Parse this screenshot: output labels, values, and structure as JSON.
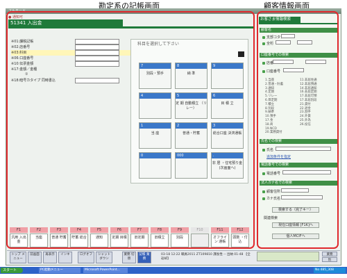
{
  "callouts": {
    "left": "勘定系の記帳画面",
    "right": "顧客情報画面"
  },
  "window": {
    "title": "フルモード"
  },
  "header": {
    "status": "● 通知可",
    "code_title": "51341 入出金"
  },
  "left_form": {
    "fields": [
      "※01:課税記帳",
      "※02:店番号",
      "※03:科目",
      "※06:口座番号",
      "※10:伝票金額",
      "※17:金額／金種",
      "①",
      "※18:暗号カタイプ 同時書込"
    ]
  },
  "keypad": {
    "prompt": "科目を選択して下さい",
    "keys": [
      {
        "num": "7",
        "label": "別段・預手"
      },
      {
        "num": "8",
        "label": "納 準"
      },
      {
        "num": "9",
        "label": ""
      },
      {
        "num": "4",
        "label": ""
      },
      {
        "num": "5",
        "label": "定 期 自動積立 （リレー）"
      },
      {
        "num": "6",
        "label": "目 積 立"
      },
      {
        "num": "1",
        "label": "当 座"
      },
      {
        "num": "2",
        "label": "普通・貯蓄"
      },
      {
        "num": "3",
        "label": "総合口座 決済通帳"
      },
      {
        "num": "0",
        "label": ""
      },
      {
        "num": "000",
        "label": ""
      },
      {
        "num": ".",
        "label": "非 居 ・住宅預り金 (次画面へ)"
      }
    ]
  },
  "fkeys": {
    "labels": [
      "F1",
      "F2",
      "F3",
      "F4",
      "F5",
      "F6",
      "F7",
      "F8",
      "F9",
      "F10",
      "F11",
      "F12"
    ],
    "buttons": [
      "汎用 入出金",
      "当座",
      "普通 貯蓄",
      "貯蓄 総合",
      "通知",
      "定期 目積",
      "旧定期",
      "旧積立",
      "別段",
      "",
      "オフライン 通帳",
      "頭数 ・付込"
    ]
  },
  "right_panel": {
    "title": "お客さま情報検索",
    "sec1": "顧客名",
    "sec1_fields": [
      "支部コタテ",
      "全桁"
    ],
    "sec2": "口座番号での検索",
    "sec2_fields": [
      "店番",
      "口座番号"
    ],
    "list_left": [
      "1.当座",
      "2.普通・貯蓄",
      "3.通知",
      "4.定期",
      "5.リレー",
      "6.目定期",
      "7.積立",
      "8.別段",
      "9.納準",
      "10.預手",
      "17.金",
      "18.商",
      "19.NCD",
      "20.業務貸付"
    ],
    "list_right": [
      "11.非居住通",
      "12.非居預通",
      "14.非居通知",
      "16.非居定期",
      "17.非居可預",
      "17.非居別段",
      "21.貸付",
      "22.退金",
      "23.割手",
      "24.外貨",
      "25.外為",
      "26.投信"
    ],
    "sec3": "氏名での検索",
    "sec3_fields": [
      "氏名",
      "追加条件を指定"
    ],
    "sec4": "電話番号での検索",
    "sec4_fields": [
      "電話番号"
    ],
    "sec5": "法人カナ名での検索",
    "sec5_fields": [
      "顧客住所",
      "カナ氏名"
    ],
    "buttons": [
      "検索する（完了キー）",
      "関連検索",
      "現在口座情報 [F1K]へ",
      "個人MCIFへ"
    ]
  },
  "taskbar": {
    "buttons": [
      "トップ メニュー",
      "前画面",
      "再表示",
      "インキ",
      "ログオフ",
      "シャット ダウン",
      "業務 切替",
      "記帳 業務"
    ],
    "info": "03-18 12:22 職員2011 ZT109810 課長性 -- 出納 01-48 【全返却】",
    "right": [
      "業務",
      "別"
    ]
  },
  "os_taskbar": {
    "start": "スタート",
    "items": [
      "PC起動メニュー",
      "Microsoft PowerPoint..."
    ],
    "clock": "No 485_308"
  }
}
